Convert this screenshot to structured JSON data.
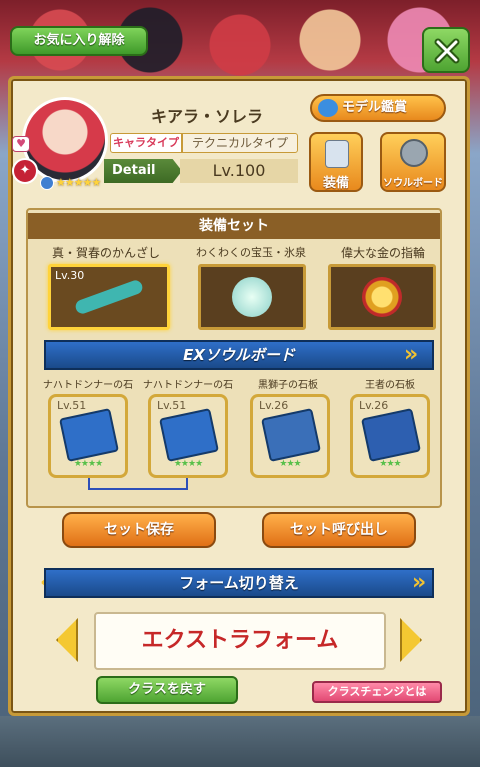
{
  "header": {
    "favorite_button": "お気に入り解除",
    "close_button_icon": "close-x-icon"
  },
  "character": {
    "name": "キアラ・ソレラ",
    "type_label": "キャラタイプ",
    "type_value": "テクニカルタイプ",
    "detail_label": "Detail",
    "level": "Lv.100",
    "stars": "★★★★★"
  },
  "actions": {
    "model_button": "モデル鑑賞",
    "equip_button": "装備",
    "soulboard_button": "ソウルボード"
  },
  "equipment": {
    "section_title": "装備セット",
    "items": [
      {
        "name": "真・賀春のかんざし",
        "level": "Lv.30"
      },
      {
        "name": "わくわくの宝玉・氷泉",
        "level": ""
      },
      {
        "name": "偉大な金の指輪",
        "level": ""
      }
    ]
  },
  "ex_soulboard": {
    "title": "EXソウルボード",
    "slabs": [
      {
        "name": "ナハトドンナーの石板",
        "level": "Lv.51",
        "stars": "★★★★"
      },
      {
        "name": "ナハトドンナーの石板",
        "level": "Lv.51",
        "stars": "★★★★"
      },
      {
        "name": "黒獅子の石板",
        "level": "Lv.26",
        "stars": "★★★"
      },
      {
        "name": "王者の石板",
        "level": "Lv.26",
        "stars": "★★★"
      }
    ]
  },
  "set_buttons": {
    "save": "セット保存",
    "load": "セット呼び出し"
  },
  "form": {
    "section_title": "フォーム切り替え",
    "current_form": "エクストラフォーム"
  },
  "class": {
    "back_button": "クラスを戻す",
    "info_button": "クラスチェンジとは"
  },
  "colors": {
    "panel": "#f3e9c9",
    "accent_green": "#4ea432",
    "accent_orange": "#e8891d",
    "accent_blue": "#2f6fc8",
    "form_text": "#c62828"
  }
}
